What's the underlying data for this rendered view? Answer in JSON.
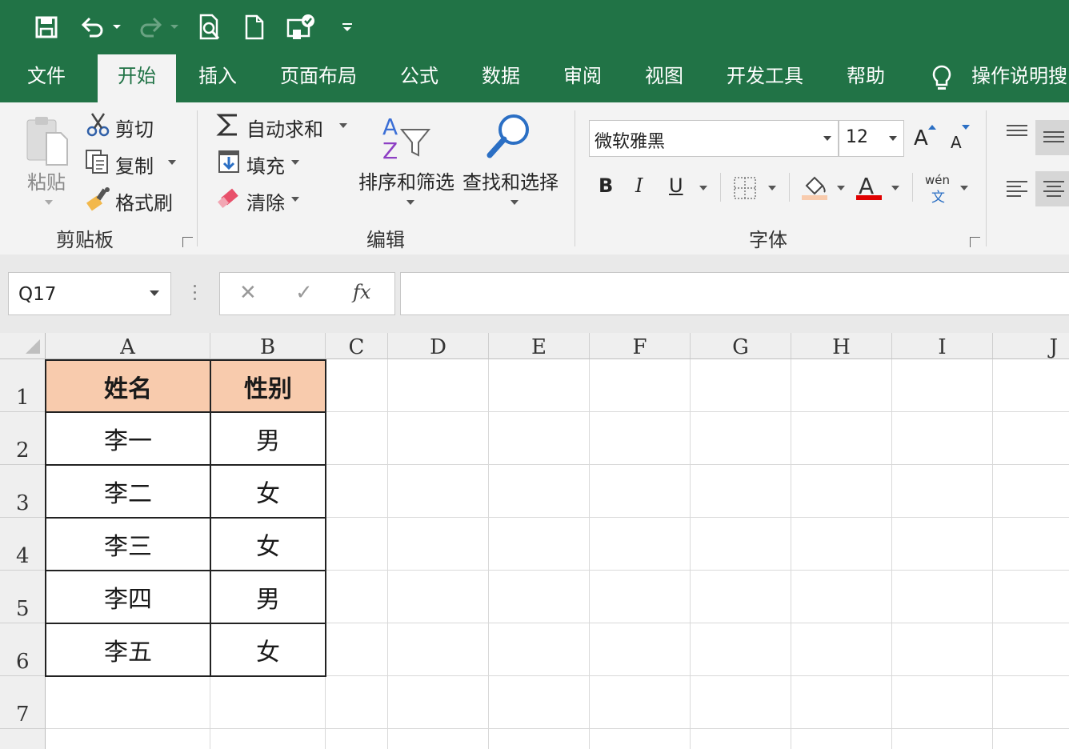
{
  "colors": {
    "accent": "#217346",
    "header_fill": "#f8cbad",
    "grid_line": "#d9d9d9"
  },
  "quick_access": {
    "icons": [
      "save-icon",
      "undo-icon",
      "redo-icon",
      "print-preview-icon",
      "new-file-icon",
      "touch-mode-icon",
      "customize-qat-icon"
    ]
  },
  "tabs": [
    "文件",
    "开始",
    "插入",
    "页面布局",
    "公式",
    "数据",
    "审阅",
    "视图",
    "开发工具",
    "帮助"
  ],
  "active_tab": "开始",
  "tell_me": "操作说明搜",
  "clipboard": {
    "paste": "粘贴",
    "cut": "剪切",
    "copy": "复制",
    "format_painter": "格式刷",
    "group": "剪贴板"
  },
  "editing": {
    "autosum": "自动求和",
    "fill": "填充",
    "clear": "清除",
    "sort_filter": "排序和筛选",
    "find_select": "查找和选择",
    "group": "编辑"
  },
  "font": {
    "name": "微软雅黑",
    "size": "12",
    "group": "字体",
    "bold": "B",
    "italic": "I",
    "underline": "U",
    "grow": "A",
    "shrink": "A",
    "phonetic_top": "wén",
    "phonetic_bottom": "文"
  },
  "formula_bar": {
    "name_box": "Q17",
    "cancel": "✕",
    "enter": "✓",
    "fx": "fx",
    "formula": ""
  },
  "columns": [
    "A",
    "B",
    "C",
    "D",
    "E",
    "F",
    "G",
    "H",
    "I",
    "J"
  ],
  "rows": [
    "1",
    "2",
    "3",
    "4",
    "5",
    "6",
    "7"
  ],
  "table": {
    "headers": [
      "姓名",
      "性别"
    ],
    "rows": [
      [
        "李一",
        "男"
      ],
      [
        "李二",
        "女"
      ],
      [
        "李三",
        "女"
      ],
      [
        "李四",
        "男"
      ],
      [
        "李五",
        "女"
      ]
    ]
  }
}
